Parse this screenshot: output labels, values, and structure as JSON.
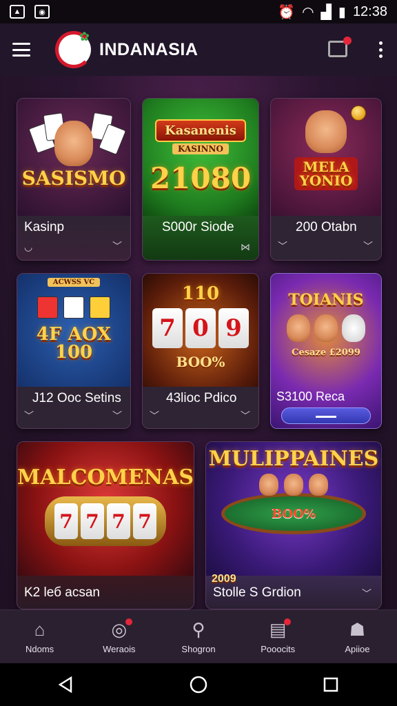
{
  "status_bar": {
    "time": "12:38"
  },
  "app": {
    "brand": "INDANASIA"
  },
  "cards": [
    {
      "label": "Kasinp",
      "art_title": "SASISMO"
    },
    {
      "label": "S000r Siode",
      "art_banner": "Kasanenis",
      "art_sub": "KASINNO",
      "art_title": "21080"
    },
    {
      "label": "200 Otabn",
      "art_title": "MELA\nYONIO"
    },
    {
      "label": "J12 Ooc Setins",
      "art_title": "4F AOX 100",
      "art_header": "ACWSS VC"
    },
    {
      "label": "43lioc Pdico",
      "art_title": "7 0 9",
      "art_top": "110",
      "art_sub": "BOO%"
    },
    {
      "label": "S3100 Reca",
      "art_title": "TOIANIS",
      "art_sub": "Cesaze £2099"
    },
    {
      "label": "K2 lеб acsan",
      "art_title": "MALCOMENAS"
    },
    {
      "label": "Stolle S Grdion",
      "art_title": "MULIPPAINES",
      "art_sub": "BOO%",
      "badge": "2009"
    }
  ],
  "bottom_nav": [
    {
      "label": "Ndoms",
      "icon": "home-icon"
    },
    {
      "label": "Weraois",
      "icon": "chat-icon"
    },
    {
      "label": "Shogron",
      "icon": "search-icon"
    },
    {
      "label": "Pooocits",
      "icon": "news-icon"
    },
    {
      "label": "Apiioe",
      "icon": "profile-icon"
    }
  ]
}
